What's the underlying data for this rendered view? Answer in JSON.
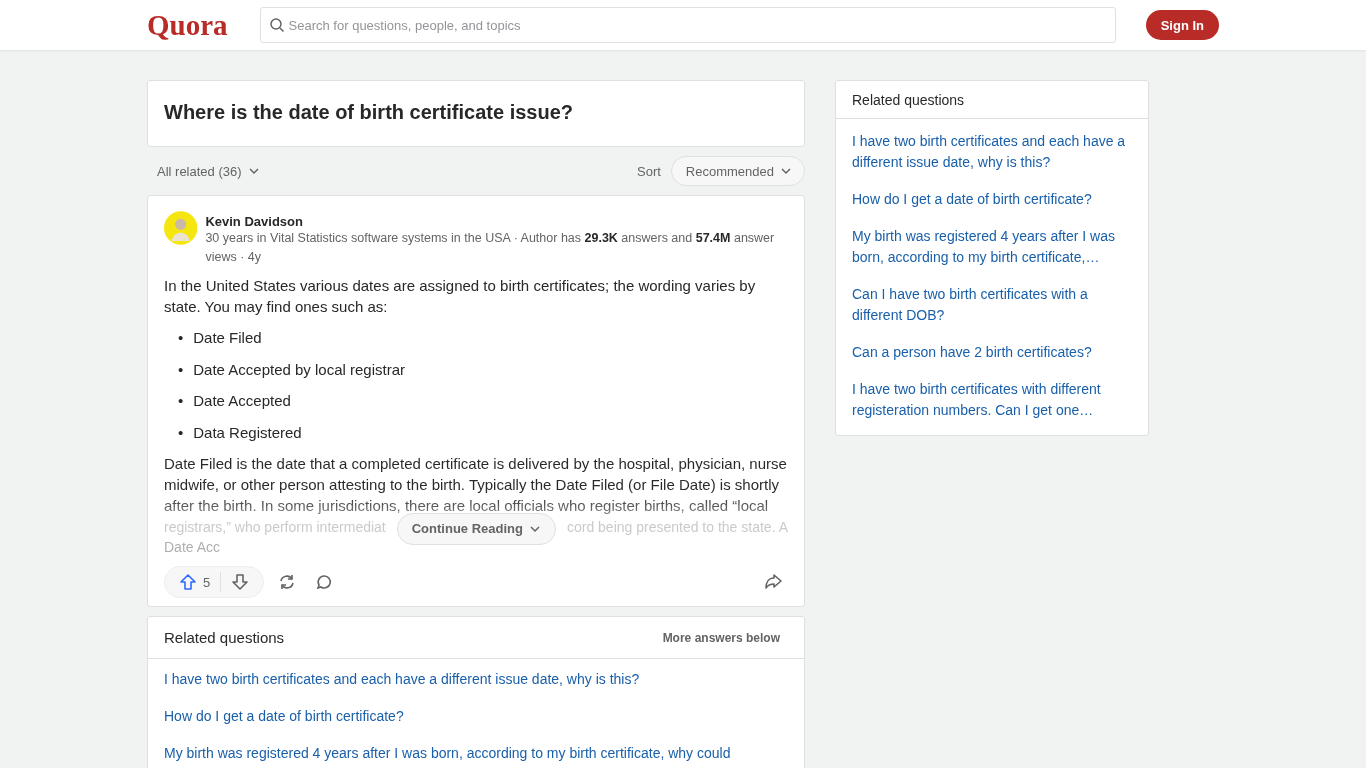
{
  "header": {
    "logo": "Quora",
    "search": {
      "placeholder": "Search for questions, people, and topics"
    },
    "sign_in": "Sign In"
  },
  "question": {
    "title": "Where is the date of birth certificate issue?"
  },
  "filter": {
    "all_related": "All related (36)",
    "sort_label": "Sort",
    "sort_value": "Recommended"
  },
  "answer": {
    "author": "Kevin Davidson",
    "credential": "30 years in Vital Statistics software systems in the USA · Author has **29.3K** answers and **57.4M** answer views · 4y",
    "intro": "In the United States various dates are assigned to birth certificates; the wording varies by state. You may find ones such as:",
    "list": [
      {
        "bullet": "•",
        "text": "Date Filed"
      },
      {
        "bullet": "•",
        "text": "Date Accepted by local registrar"
      },
      {
        "bullet": "•",
        "text": "Date Accepted"
      },
      {
        "bullet": "•",
        "text": "Data Registered"
      }
    ],
    "paragraph": "Date Filed is the date that a completed certificate is delivered by the hospital, physician, nurse midwife, or other person attesting to the birth. Typically the Date Filed (or File Date) is shortly after the birth. In some jurisdictions, there are local officials who register births, called “local",
    "faded_left": "registrars,” who perform intermediat",
    "faded_right": "cord being presented to the state. A",
    "faded_last": "Date Acc",
    "continue": "Continue Reading",
    "upvotes": "5"
  },
  "related_inline": {
    "title": "Related questions",
    "more": "More answers below",
    "items": [
      "I have two birth certificates and each have a different issue date, why is this?",
      "How do I get a date of birth certificate?",
      "My birth was registered 4 years after I was born, according to my birth certificate, why could"
    ]
  },
  "sidebar": {
    "title": "Related questions",
    "items": [
      "I have two birth certificates and each have a different issue date, why is this?",
      "How do I get a date of birth certificate?",
      "My birth was registered 4 years after I was born, according to my birth certificate,…",
      "Can I have two birth certificates with a different DOB?",
      "Can a person have 2 birth certificates?",
      "I have two birth certificates with different registeration numbers. Can I get one…"
    ]
  }
}
